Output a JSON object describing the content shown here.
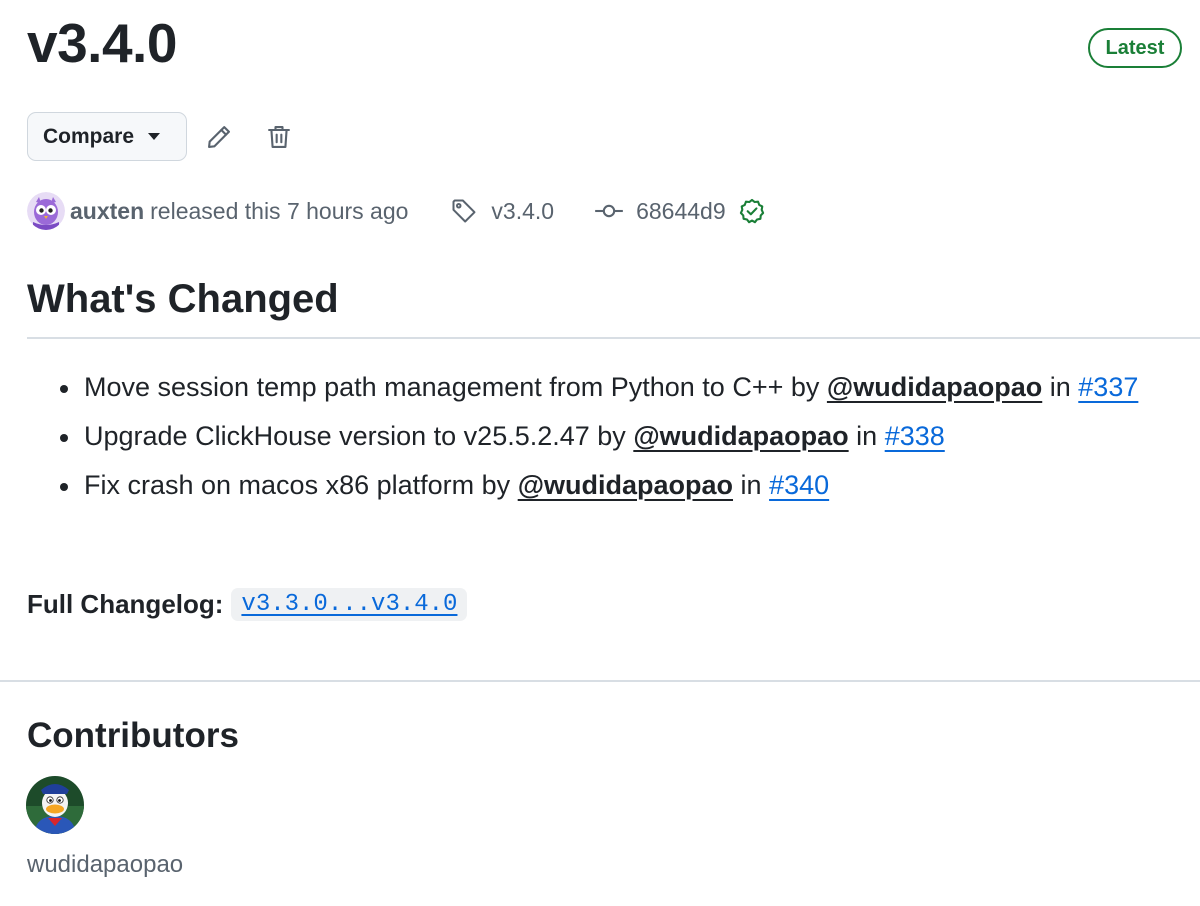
{
  "release": {
    "title": "v3.4.0",
    "badge": "Latest",
    "actions": {
      "compare_label": "Compare",
      "edit_icon": "pencil-icon",
      "delete_icon": "trash-icon"
    },
    "meta": {
      "author": "auxten",
      "released_text": "released this 7 hours ago",
      "tag": "v3.4.0",
      "commit": "68644d9",
      "verified_icon": "check-circle-icon"
    }
  },
  "notes": {
    "heading": "What's Changed",
    "changes": [
      {
        "text": "Move session temp path management from Python to C++ by",
        "author": "@wudidapaopao",
        "in": "in",
        "pr": "#337"
      },
      {
        "text": "Upgrade ClickHouse version to v25.5.2.47 by",
        "author": "@wudidapaopao",
        "in": "in",
        "pr": "#338"
      },
      {
        "text": "Fix crash on macos x86 platform by",
        "author": "@wudidapaopao",
        "in": "in",
        "pr": "#340"
      }
    ],
    "changelog_label": "Full Changelog:",
    "changelog_range": "v3.3.0...v3.4.0"
  },
  "contributors": {
    "heading": "Contributors",
    "people": [
      {
        "name": "wudidapaopao"
      }
    ]
  },
  "colors": {
    "text": "#1f2328",
    "muted": "#59636e",
    "link": "#0969da",
    "success": "#1a7f37",
    "border": "#d0d7de"
  }
}
